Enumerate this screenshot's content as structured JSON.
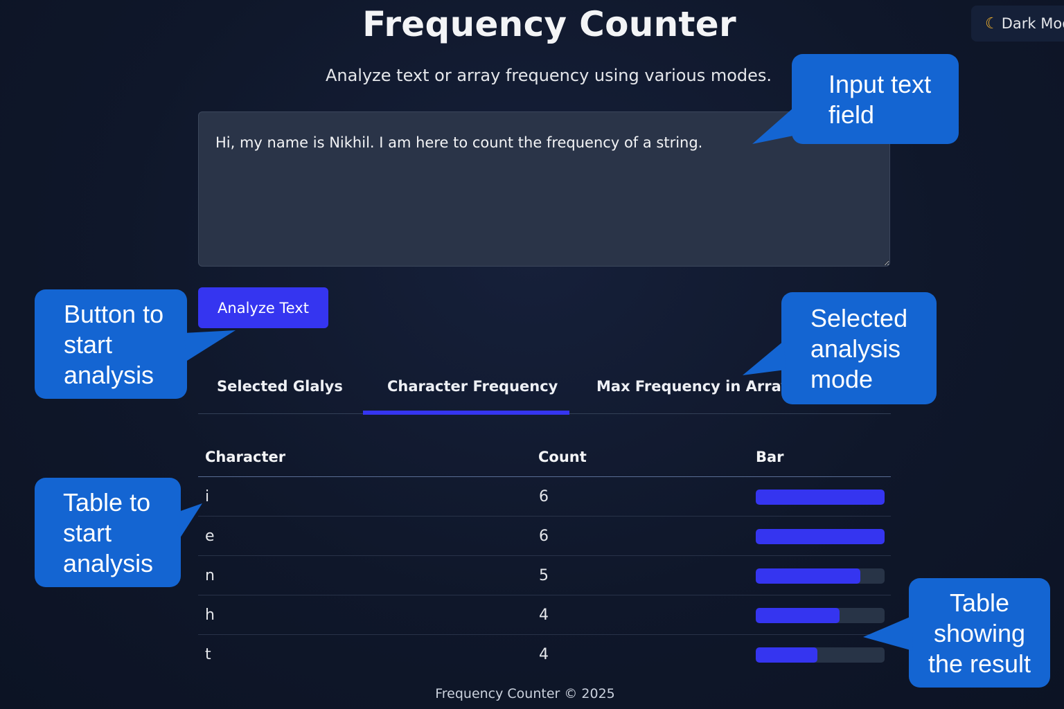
{
  "header": {
    "title": "Frequency Counter",
    "subtitle": "Analyze text or array frequency using various modes.",
    "dark_mode_label": "Dark Mode"
  },
  "input": {
    "value": "Hi, my name is Nikhil. I am here to count the frequency of a string."
  },
  "analyze_button": {
    "label": "Analyze Text"
  },
  "tabs": [
    {
      "label": "Selected Glalys",
      "active": false
    },
    {
      "label": "Character Frequency",
      "active": true
    },
    {
      "label": "Max Frequency in Array",
      "active": false
    }
  ],
  "table": {
    "headers": [
      "Character",
      "Count",
      "Bar"
    ],
    "rows": [
      {
        "char": "i",
        "count": "6",
        "bar_fraction": 1.0
      },
      {
        "char": "e",
        "count": "6",
        "bar_fraction": 1.0
      },
      {
        "char": "n",
        "count": "5",
        "bar_fraction": 0.81
      },
      {
        "char": "h",
        "count": "4",
        "bar_fraction": 0.65
      },
      {
        "char": "t",
        "count": "4",
        "bar_fraction": 0.48
      }
    ]
  },
  "footer": {
    "text": "Frequency Counter © 2025"
  },
  "callouts": {
    "input_field": [
      "Input text",
      "field"
    ],
    "analyze_button": [
      "Button to",
      "start",
      "analysis"
    ],
    "mode": [
      "Selected",
      "analysis",
      "mode"
    ],
    "table": [
      "Table to",
      "start",
      "analysis"
    ],
    "result": [
      "Table",
      "showing",
      "the result"
    ]
  },
  "colors": {
    "background": "#0f172a",
    "accent": "#3535f0",
    "callout": "#1465d2",
    "input_bg": "#2a3448"
  },
  "icons": {
    "dark_mode": "moon-icon"
  }
}
